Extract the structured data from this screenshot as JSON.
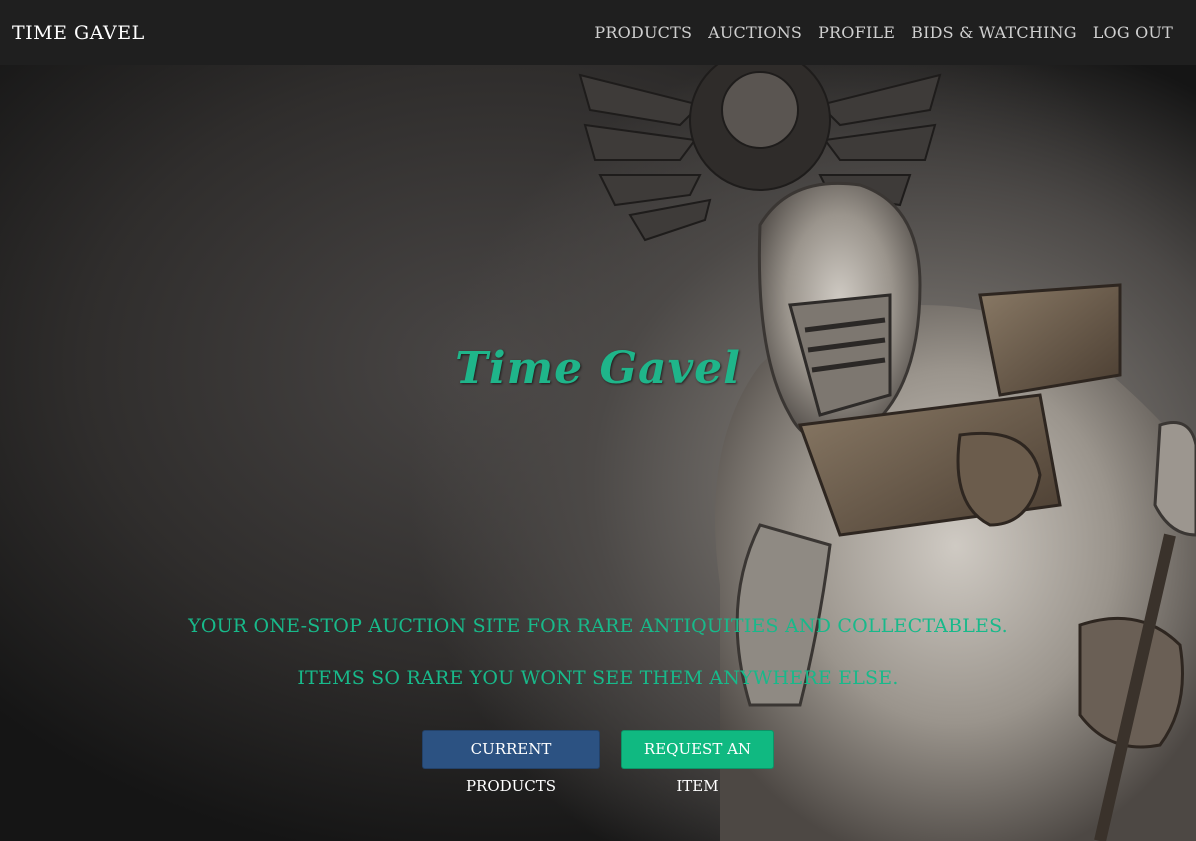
{
  "navbar": {
    "brand": "Time Gavel",
    "links": [
      "Products",
      "Auctions",
      "Profile",
      "Bids & Watching",
      "Log Out"
    ]
  },
  "hero": {
    "title": "Time Gavel",
    "tagline1": "Your one-stop auction site for rare antiquities and collectables.",
    "tagline2": "Items so rare you wont see them anywhere else.",
    "buttons": {
      "current_products": "Current Products",
      "request_item": "Request an Item"
    },
    "image": "armored-knight-statue"
  },
  "colors": {
    "navbar_bg": "#1f1f1f",
    "accent_green": "#10b981",
    "primary_blue": "#2c5282",
    "title_green": "#1fb58a"
  }
}
